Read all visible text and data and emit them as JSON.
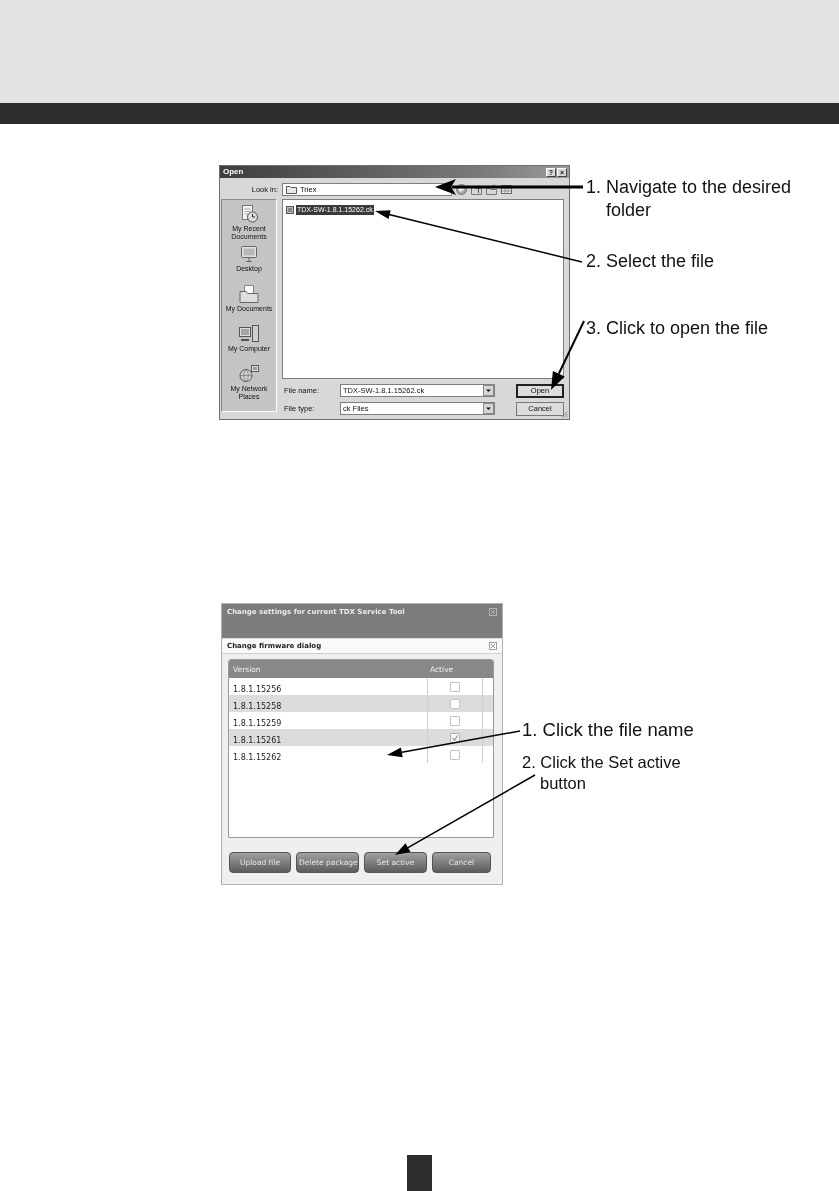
{
  "open_dialog": {
    "title": "Open",
    "help_button": "?",
    "close_button": "×",
    "look_in": {
      "label": "Look in:",
      "value": "Triex"
    },
    "places": [
      {
        "kind": "recent",
        "label": "My Recent Documents"
      },
      {
        "kind": "desktop",
        "label": "Desktop"
      },
      {
        "kind": "documents",
        "label": "My Documents"
      },
      {
        "kind": "computer",
        "label": "My Computer"
      },
      {
        "kind": "network",
        "label": "My Network Places"
      }
    ],
    "files": [
      {
        "name": "TDX-SW-1.8.1.15262.ck",
        "selected": true
      }
    ],
    "file_name": {
      "label": "File name:",
      "value": "TDX-SW-1.8.1.15262.ck"
    },
    "file_type": {
      "label": "File type:",
      "value": "ck Files"
    },
    "buttons": [
      {
        "label": "Open",
        "default": true
      },
      {
        "label": "Cancel",
        "default": false
      }
    ]
  },
  "open_callouts": [
    "1. Navigate to the desired folder",
    "2. Select the file",
    "3. Click to open the file"
  ],
  "settings_window": {
    "title": "Change settings for current TDX Service Tool"
  },
  "firmware_dialog": {
    "title": "Change firmware dialog",
    "columns": [
      "Version",
      "Active"
    ],
    "rows": [
      {
        "version": "1.8.1.15256",
        "active": false
      },
      {
        "version": "1.8.1.15258",
        "active": false
      },
      {
        "version": "1.8.1.15259",
        "active": false
      },
      {
        "version": "1.8.1.15261",
        "active": true
      },
      {
        "version": "1.8.1.15262",
        "active": false
      }
    ],
    "buttons": [
      "Upload file",
      "Delete package",
      "Set active",
      "Cancel"
    ]
  },
  "firmware_callouts": [
    "1. Click the file name",
    "2. Click the Set active button"
  ]
}
